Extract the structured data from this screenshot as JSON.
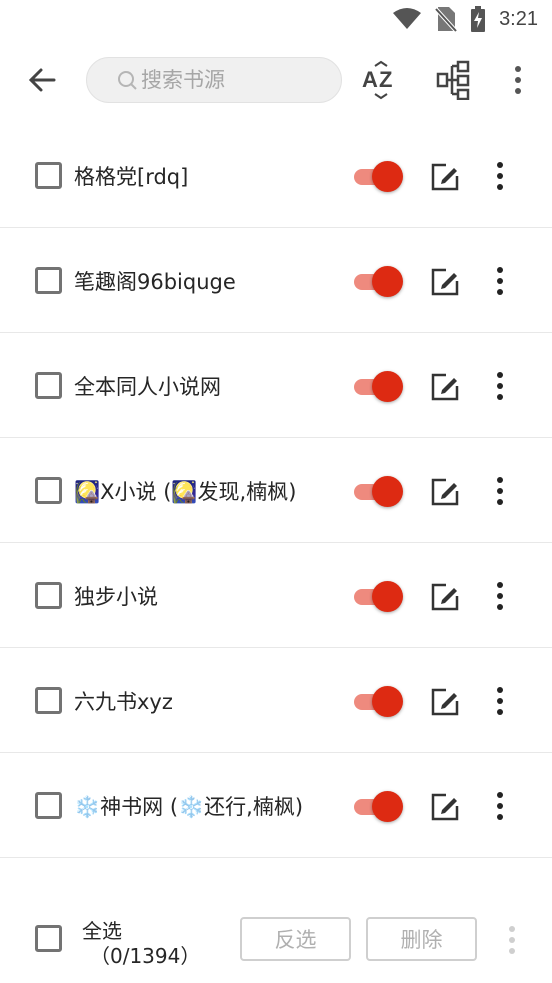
{
  "status_bar": {
    "time": "3:21"
  },
  "toolbar": {
    "search_placeholder": "搜索书源",
    "icons": [
      "back-arrow-icon",
      "search-icon",
      "sort-az-icon",
      "group-icon",
      "more-vert-icon"
    ]
  },
  "sources": [
    {
      "name": "格格党[rdq]",
      "enabled": true
    },
    {
      "name": "笔趣阁96biquge",
      "enabled": true
    },
    {
      "name": "全本同人小说网",
      "enabled": true
    },
    {
      "name": "🎑X小说 (🎑发现,楠枫)",
      "enabled": true
    },
    {
      "name": "独步小说",
      "enabled": true
    },
    {
      "name": "六九书xyz",
      "enabled": true
    },
    {
      "name": "❄️神书网 (❄️还行,楠枫)",
      "enabled": true
    }
  ],
  "bottom_bar": {
    "select_all_label": "全选",
    "selection_count": "（0/1394）",
    "invert_label": "反选",
    "delete_label": "删除"
  },
  "colors": {
    "switch_thumb": "#dd2a12",
    "switch_track": "#ee8a7e",
    "icon_gray": "#444444"
  }
}
